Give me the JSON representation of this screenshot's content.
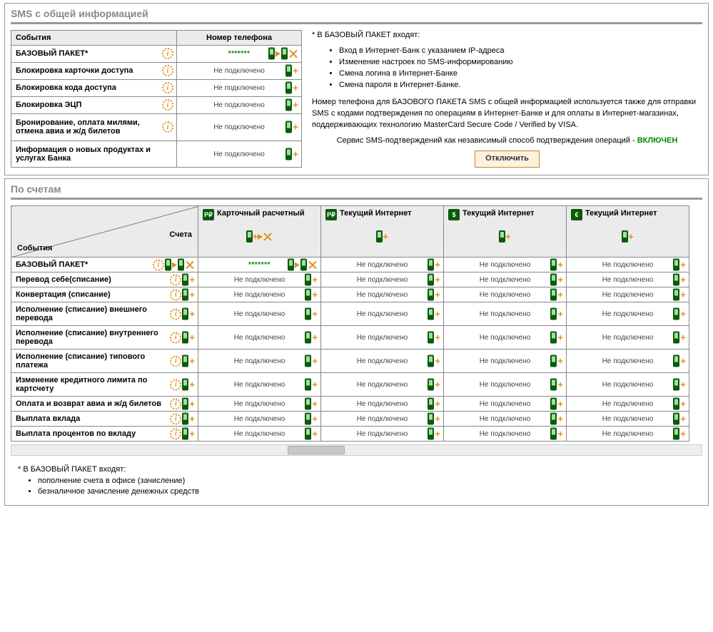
{
  "panel1": {
    "title": "SMS с общей информацией",
    "headers": {
      "events": "События",
      "phone": "Номер телефона"
    },
    "rows": [
      {
        "event": "БАЗОВЫЙ ПАКЕТ*",
        "status": "*******",
        "connected": true
      },
      {
        "event": "Блокировка карточки доступа",
        "status": "Не подключено",
        "connected": false
      },
      {
        "event": "Блокировка кода доступа",
        "status": "Не подключено",
        "connected": false
      },
      {
        "event": "Блокировка ЭЦП",
        "status": "Не подключено",
        "connected": false
      },
      {
        "event": "Бронирование, оплата милями, отмена авиа и ж/д билетов",
        "status": "Не подключено",
        "connected": false
      },
      {
        "event": "Информация о новых продуктах и услугах Банка",
        "status": "Не подключено",
        "connected": false
      }
    ],
    "info": {
      "lead": "* В БАЗОВЫЙ ПАКЕТ входят:",
      "items": [
        "Вход в Интернет-Банк с указанием IP-адреса",
        "Изменение настроек по SMS-информированию",
        "Смена логина в Интернет-Банке",
        "Смена пароля в Интернет-Банке."
      ],
      "para": "Номер телефона для БАЗОВОГО ПАКЕТА SMS с общей информацией используется также для отправки SMS с кодами подтверждения по операциям в Интернет-Банке и для оплаты в Интернет-магазинах, поддерживающих технологию MasterCard Secure Code / Verified by VISA.",
      "service_prefix": "Сервис SMS-подтверждений как независимый способ подтверждения операций - ",
      "service_state": "ВКЛЮЧЕН",
      "button": "Отключить"
    }
  },
  "panel2": {
    "title": "По счетам",
    "diag": {
      "accounts": "Счета",
      "events": "События"
    },
    "accounts": [
      {
        "glyph": "P₽",
        "name": "Карточный расчетный",
        "first": true
      },
      {
        "glyph": "P₽",
        "name": "Текущий Интернет",
        "first": false
      },
      {
        "glyph": "$",
        "name": "Текущий Интернет",
        "first": false
      },
      {
        "glyph": "€",
        "name": "Текущий Интернет",
        "first": false
      }
    ],
    "rows": [
      {
        "event": "БАЗОВЫЙ ПАКЕТ*",
        "big_icons": true,
        "cells": [
          {
            "status": "*******",
            "connected": true
          },
          {
            "status": "Не подключено",
            "connected": false
          },
          {
            "status": "Не подключено",
            "connected": false
          },
          {
            "status": "Не подключено",
            "connected": false
          }
        ]
      },
      {
        "event": "Перевод себе(списание)",
        "cells": [
          {
            "status": "Не подключено"
          },
          {
            "status": "Не подключено"
          },
          {
            "status": "Не подключено"
          },
          {
            "status": "Не подключено"
          }
        ]
      },
      {
        "event": "Конвертация (списание)",
        "cells": [
          {
            "status": "Не подключено"
          },
          {
            "status": "Не подключено"
          },
          {
            "status": "Не подключено"
          },
          {
            "status": "Не подключено"
          }
        ]
      },
      {
        "event": "Исполнение (списание) внешнего перевода",
        "cells": [
          {
            "status": "Не подключено"
          },
          {
            "status": "Не подключено"
          },
          {
            "status": "Не подключено"
          },
          {
            "status": "Не подключено"
          }
        ]
      },
      {
        "event": "Исполнение (списание) внутреннего перевода",
        "cells": [
          {
            "status": "Не подключено"
          },
          {
            "status": "Не подключено"
          },
          {
            "status": "Не подключено"
          },
          {
            "status": "Не подключено"
          }
        ]
      },
      {
        "event": "Исполнение (списание) типового платежа",
        "cells": [
          {
            "status": "Не подключено"
          },
          {
            "status": "Не подключено"
          },
          {
            "status": "Не подключено"
          },
          {
            "status": "Не подключено"
          }
        ]
      },
      {
        "event": "Изменение кредитного лимита по картсчету",
        "cells": [
          {
            "status": "Не подключено"
          },
          {
            "status": "Не подключено"
          },
          {
            "status": "Не подключено"
          },
          {
            "status": "Не подключено"
          }
        ]
      },
      {
        "event": "Оплата и возврат авиа и ж/д билетов",
        "cells": [
          {
            "status": "Не подключено"
          },
          {
            "status": "Не подключено"
          },
          {
            "status": "Не подключено"
          },
          {
            "status": "Не подключено"
          }
        ]
      },
      {
        "event": "Выплата вклада",
        "cells": [
          {
            "status": "Не подключено"
          },
          {
            "status": "Не подключено"
          },
          {
            "status": "Не подключено"
          },
          {
            "status": "Не подключено"
          }
        ]
      },
      {
        "event": "Выплата процентов по вкладу",
        "cells": [
          {
            "status": "Не подключено"
          },
          {
            "status": "Не подключено"
          },
          {
            "status": "Не подключено"
          },
          {
            "status": "Не подключено"
          }
        ]
      }
    ],
    "footer": {
      "lead": "* В БАЗОВЫЙ ПАКЕТ входят:",
      "items": [
        "пополнение счета в офисе (зачисление)",
        "безналичное зачисление денежных средств"
      ]
    }
  }
}
